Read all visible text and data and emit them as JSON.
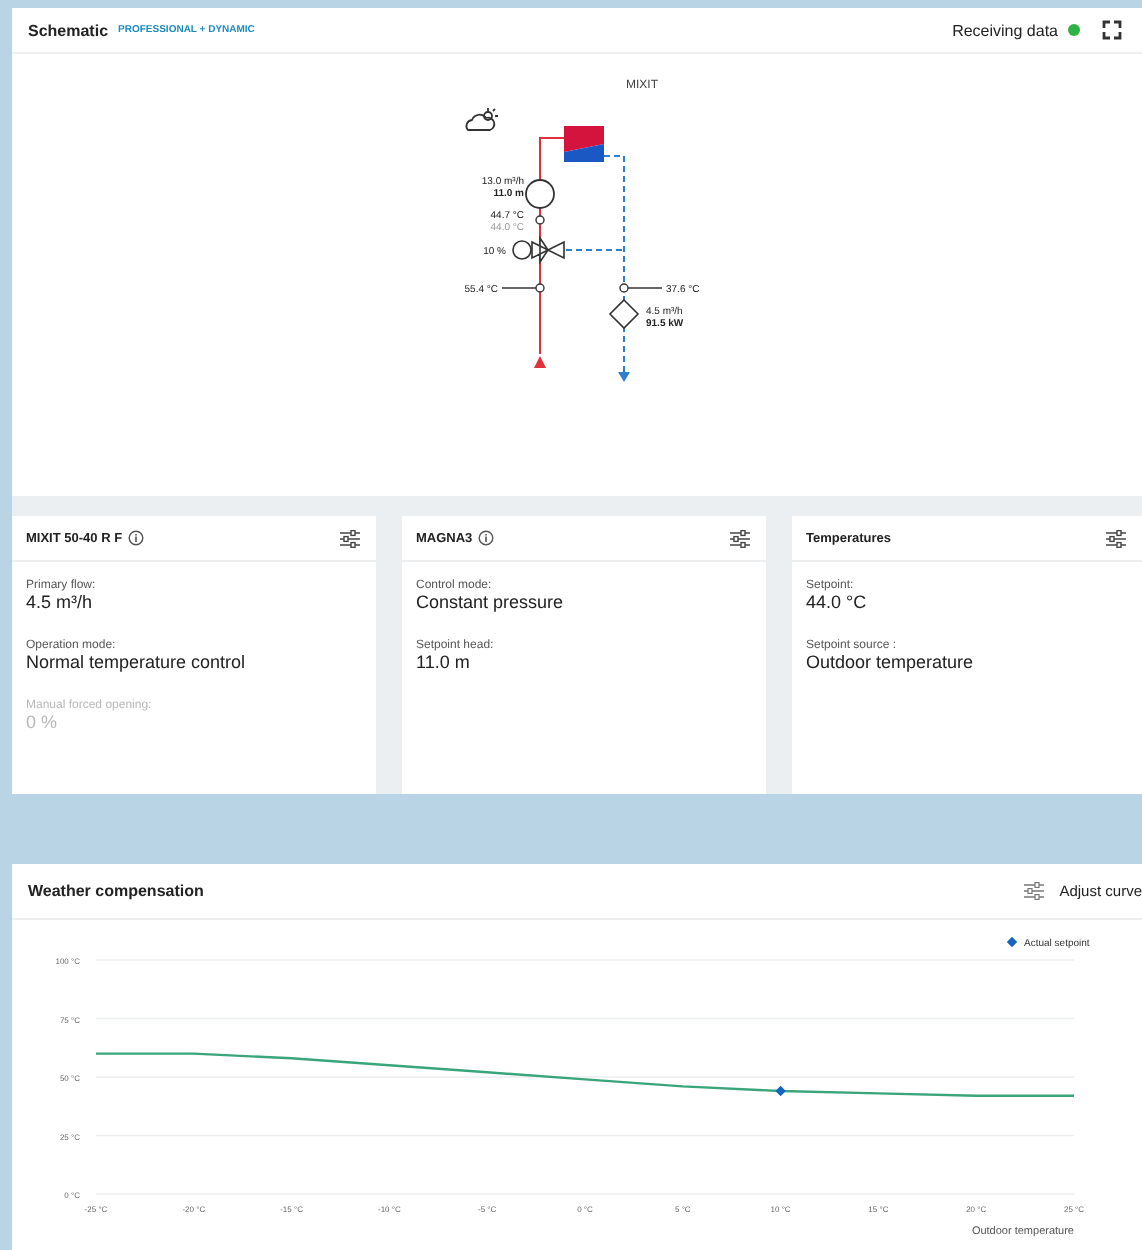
{
  "header": {
    "title": "Schematic",
    "edition": "PROFESSIONAL + DYNAMIC",
    "status": "Receiving data",
    "receiving": true
  },
  "schematic": {
    "title": "MIXIT",
    "pump": {
      "flow": "13.0 m³/h",
      "head": "11.0 m"
    },
    "supply_sensor": {
      "reading": "44.7 °C",
      "setpoint": "44.0 °C"
    },
    "valve": {
      "opening": "10 %"
    },
    "return_sensor": {
      "reading": "55.4 °C"
    },
    "secondary_sensor": {
      "reading": "37.6 °C"
    },
    "meter": {
      "flow": "4.5 m³/h",
      "power": "91.5 kW"
    }
  },
  "cards": [
    {
      "title": "MIXIT 50-40 R F",
      "info": true,
      "fields": [
        {
          "label": "Primary flow:",
          "value": "4.5 m³/h",
          "disabled": false
        },
        {
          "label": "Operation mode:",
          "value": "Normal temperature control",
          "disabled": false
        },
        {
          "label": "Manual forced opening:",
          "value": "0 %",
          "disabled": true
        }
      ]
    },
    {
      "title": "MAGNA3",
      "info": true,
      "fields": [
        {
          "label": "Control mode:",
          "value": "Constant pressure",
          "disabled": false
        },
        {
          "label": "Setpoint head:",
          "value": "11.0 m",
          "disabled": false
        }
      ]
    },
    {
      "title": "Temperatures",
      "info": false,
      "fields": [
        {
          "label": "Setpoint:",
          "value": "44.0 °C",
          "disabled": false
        },
        {
          "label": "Setpoint source :",
          "value": "Outdoor temperature",
          "disabled": false
        }
      ]
    }
  ],
  "weather": {
    "title": "Weather compensation",
    "action": "Adjust curve",
    "chart_data": {
      "type": "line",
      "xlabel": "Outdoor temperature",
      "x": [
        -25,
        -20,
        -15,
        -10,
        -5,
        0,
        5,
        10,
        15,
        20,
        25
      ],
      "series": [
        {
          "color": "#3aa57a",
          "values": [
            60,
            60,
            58,
            55,
            52,
            49,
            46,
            44,
            43,
            42,
            42
          ]
        },
        {
          "name": "Actual setpoint",
          "marker": "diamond",
          "color": "#1565c0",
          "values": [
            null,
            null,
            null,
            null,
            null,
            null,
            null,
            44,
            null,
            null,
            null
          ]
        }
      ],
      "grid": true,
      "xlim": [
        -25,
        25
      ],
      "ylim": [
        0,
        100
      ],
      "xticks": [
        {
          "value": -25,
          "label": "-25 °C"
        },
        {
          "value": -20,
          "label": "-20 °C"
        },
        {
          "value": -15,
          "label": "-15 °C"
        },
        {
          "value": -10,
          "label": "-10 °C"
        },
        {
          "value": -5,
          "label": "-5 °C"
        },
        {
          "value": 0,
          "label": "0 °C"
        },
        {
          "value": 5,
          "label": "5 °C"
        },
        {
          "value": 10,
          "label": "10 °C"
        },
        {
          "value": 15,
          "label": "15 °C"
        },
        {
          "value": 20,
          "label": "20 °C"
        },
        {
          "value": 25,
          "label": "25 °C"
        }
      ],
      "yticks": [
        {
          "value": 0,
          "label": "0 °C"
        },
        {
          "value": 25,
          "label": "25 °C"
        },
        {
          "value": 50,
          "label": "50 °C"
        },
        {
          "value": 75,
          "label": "75 °C"
        },
        {
          "value": 100,
          "label": "100 °C"
        }
      ]
    }
  }
}
